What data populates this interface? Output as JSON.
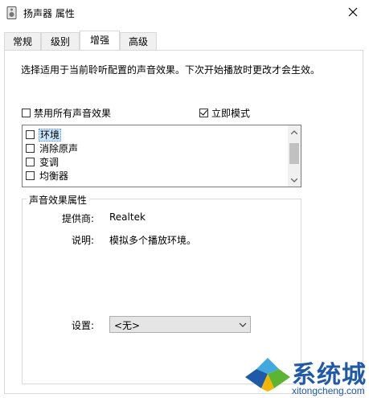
{
  "window": {
    "title": "扬声器 属性",
    "icon": "speaker-icon"
  },
  "tabs": [
    {
      "label": "常规",
      "active": false
    },
    {
      "label": "级别",
      "active": false
    },
    {
      "label": "增强",
      "active": true
    },
    {
      "label": "高级",
      "active": false
    }
  ],
  "description": "选择适用于当前聆听配置的声音效果。下次开始播放时更改才会生效。",
  "disable_all": {
    "label": "禁用所有声音效果",
    "checked": false
  },
  "immediate_mode": {
    "label": "立即模式",
    "checked": true
  },
  "effects": [
    {
      "label": "环境",
      "checked": false,
      "selected": true
    },
    {
      "label": "消除原声",
      "checked": false,
      "selected": false
    },
    {
      "label": "变调",
      "checked": false,
      "selected": false
    },
    {
      "label": "均衡器",
      "checked": false,
      "selected": false
    }
  ],
  "properties": {
    "group_title": "声音效果属性",
    "provider_label": "提供商:",
    "provider_value": "Realtek",
    "desc_label": "说明:",
    "desc_value": "模拟多个播放环境。",
    "settings_label": "设置:",
    "settings_value": "<无>"
  },
  "watermark": {
    "text": "系统城",
    "url": "xitongcheng.com",
    "colors": {
      "blue": "#1e5aa8",
      "light_blue": "#3fa9e0",
      "green": "#5cb531",
      "yellow": "#f2b600"
    }
  }
}
